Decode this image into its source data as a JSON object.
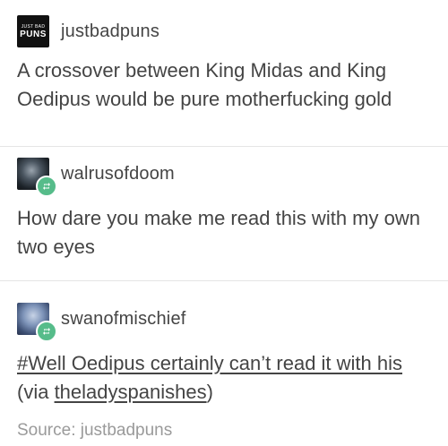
{
  "posts": [
    {
      "username": "justbadpuns",
      "avatar": {
        "small_text": "JUST BAD",
        "big_text": "PUNS"
      },
      "text": "A crossover between King Midas and King Oedipus would be pure motherfucking gold"
    },
    {
      "username": "walrusofdoom",
      "text": "How dare you make me read this with my own two eyes"
    },
    {
      "username": "swanofmischief",
      "link_text": "#Well Oedipus certainly can’t read it with his",
      "via_prefix": " (via ",
      "via_user": "theladyspanishes",
      "via_suffix": ")"
    }
  ],
  "source": "Source: justbadpuns",
  "colors": {
    "reblog_badge": "#56bc8a",
    "text": "#444444",
    "muted": "#9a9a9a"
  },
  "icons": [
    "reblog-icon"
  ]
}
